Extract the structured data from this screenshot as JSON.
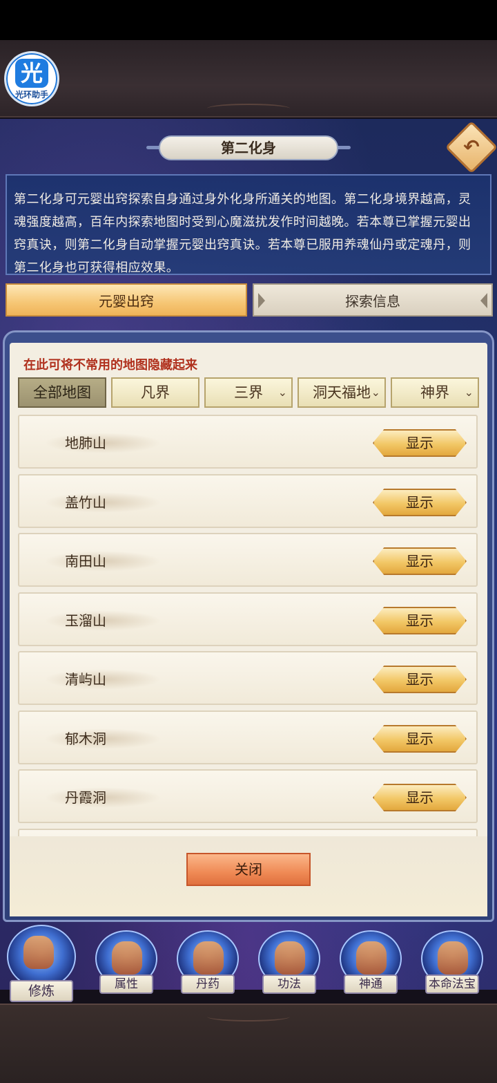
{
  "logo": {
    "glyph": "光",
    "caption": "光环助手"
  },
  "header": {
    "title": "第二化身",
    "back_icon": "return-arrow-icon",
    "back_glyph": "↶"
  },
  "description": "第二化身可元婴出窍探索自身通过身外化身所通关的地图。第二化身境界越高，灵魂强度越高，百年内探索地图时受到心魔滋扰发作时间越晚。若本尊已掌握元婴出窍真诀，则第二化身自动掌握元婴出窍真诀。若本尊已服用养魂仙丹或定魂丹，则第二化身也可获得相应效果。",
  "tabs": [
    {
      "label": "元婴出窍",
      "active": true
    },
    {
      "label": "探索信息",
      "active": false
    }
  ],
  "panel": {
    "hint": "在此可将不常用的地图隐藏起来",
    "filters": [
      {
        "label": "全部地图",
        "active": true,
        "dropdown": false
      },
      {
        "label": "凡界",
        "active": false,
        "dropdown": false
      },
      {
        "label": "三界",
        "active": false,
        "dropdown": true
      },
      {
        "label": "洞天福地",
        "active": false,
        "dropdown": true
      },
      {
        "label": "神界",
        "active": false,
        "dropdown": true
      }
    ],
    "maps": [
      {
        "name": "地肺山",
        "action": "显示"
      },
      {
        "name": "盖竹山",
        "action": "显示"
      },
      {
        "name": "南田山",
        "action": "显示"
      },
      {
        "name": "玉溜山",
        "action": "显示"
      },
      {
        "name": "清屿山",
        "action": "显示"
      },
      {
        "name": "郁木洞",
        "action": "显示"
      },
      {
        "name": "丹霞洞",
        "action": "显示"
      }
    ],
    "close_label": "关闭"
  },
  "bottom_nav": [
    {
      "label": "修炼",
      "icon": "cultivation-icon",
      "current": true
    },
    {
      "label": "属性",
      "icon": "attributes-icon",
      "current": false
    },
    {
      "label": "丹药",
      "icon": "pill-icon",
      "current": false
    },
    {
      "label": "功法",
      "icon": "technique-scroll-icon",
      "current": false
    },
    {
      "label": "神通",
      "icon": "divine-book-icon",
      "current": false
    },
    {
      "label": "本命法宝",
      "icon": "treasure-icon",
      "current": false
    }
  ]
}
